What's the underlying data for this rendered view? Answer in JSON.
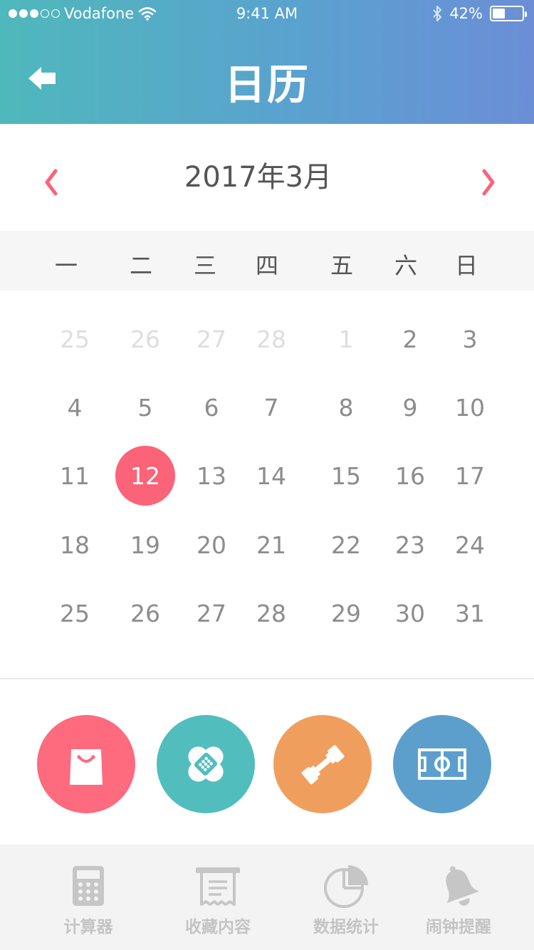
{
  "status_bar": {
    "carrier": "Vodafone",
    "time": "9:41 AM",
    "battery_percent": "42%",
    "battery_level": 0.42,
    "signal_bars_filled": 3,
    "signal_bars_total": 5
  },
  "header": {
    "title": "日历",
    "background_colors": [
      "#4fb8bb",
      "#6b8ed6"
    ]
  },
  "calendar": {
    "month_title": "2017年3月",
    "accent_color": "#fb6378",
    "weekdays": [
      "一",
      "二",
      "三",
      "四",
      "五",
      "六",
      "日"
    ],
    "weeks": [
      [
        {
          "d": "25",
          "muted": true
        },
        {
          "d": "26",
          "muted": true
        },
        {
          "d": "27",
          "muted": true
        },
        {
          "d": "28",
          "muted": true
        },
        {
          "d": "1",
          "muted": true
        },
        {
          "d": "2"
        },
        {
          "d": "3"
        }
      ],
      [
        {
          "d": "4"
        },
        {
          "d": "5"
        },
        {
          "d": "6"
        },
        {
          "d": "7"
        },
        {
          "d": "8"
        },
        {
          "d": "9"
        },
        {
          "d": "10"
        }
      ],
      [
        {
          "d": "11"
        },
        {
          "d": "12",
          "selected": true
        },
        {
          "d": "13"
        },
        {
          "d": "14"
        },
        {
          "d": "15"
        },
        {
          "d": "16"
        },
        {
          "d": "17"
        }
      ],
      [
        {
          "d": "18"
        },
        {
          "d": "19"
        },
        {
          "d": "20"
        },
        {
          "d": "21"
        },
        {
          "d": "22"
        },
        {
          "d": "23"
        },
        {
          "d": "24"
        }
      ],
      [
        {
          "d": "25"
        },
        {
          "d": "26"
        },
        {
          "d": "27"
        },
        {
          "d": "28"
        },
        {
          "d": "29"
        },
        {
          "d": "30"
        },
        {
          "d": "31"
        }
      ]
    ]
  },
  "categories": [
    {
      "icon": "shopping-bag-icon",
      "color": "#fe6a7e"
    },
    {
      "icon": "bandage-icon",
      "color": "#52bdbd"
    },
    {
      "icon": "dumbbell-icon",
      "color": "#f09e5e"
    },
    {
      "icon": "soccer-field-icon",
      "color": "#5d9fcc"
    }
  ],
  "tabs": [
    {
      "label": "计算器",
      "icon": "calculator-icon"
    },
    {
      "label": "收藏内容",
      "icon": "receipt-icon"
    },
    {
      "label": "数据统计",
      "icon": "pie-chart-icon"
    },
    {
      "label": "闹钟提醒",
      "icon": "bell-icon"
    }
  ]
}
